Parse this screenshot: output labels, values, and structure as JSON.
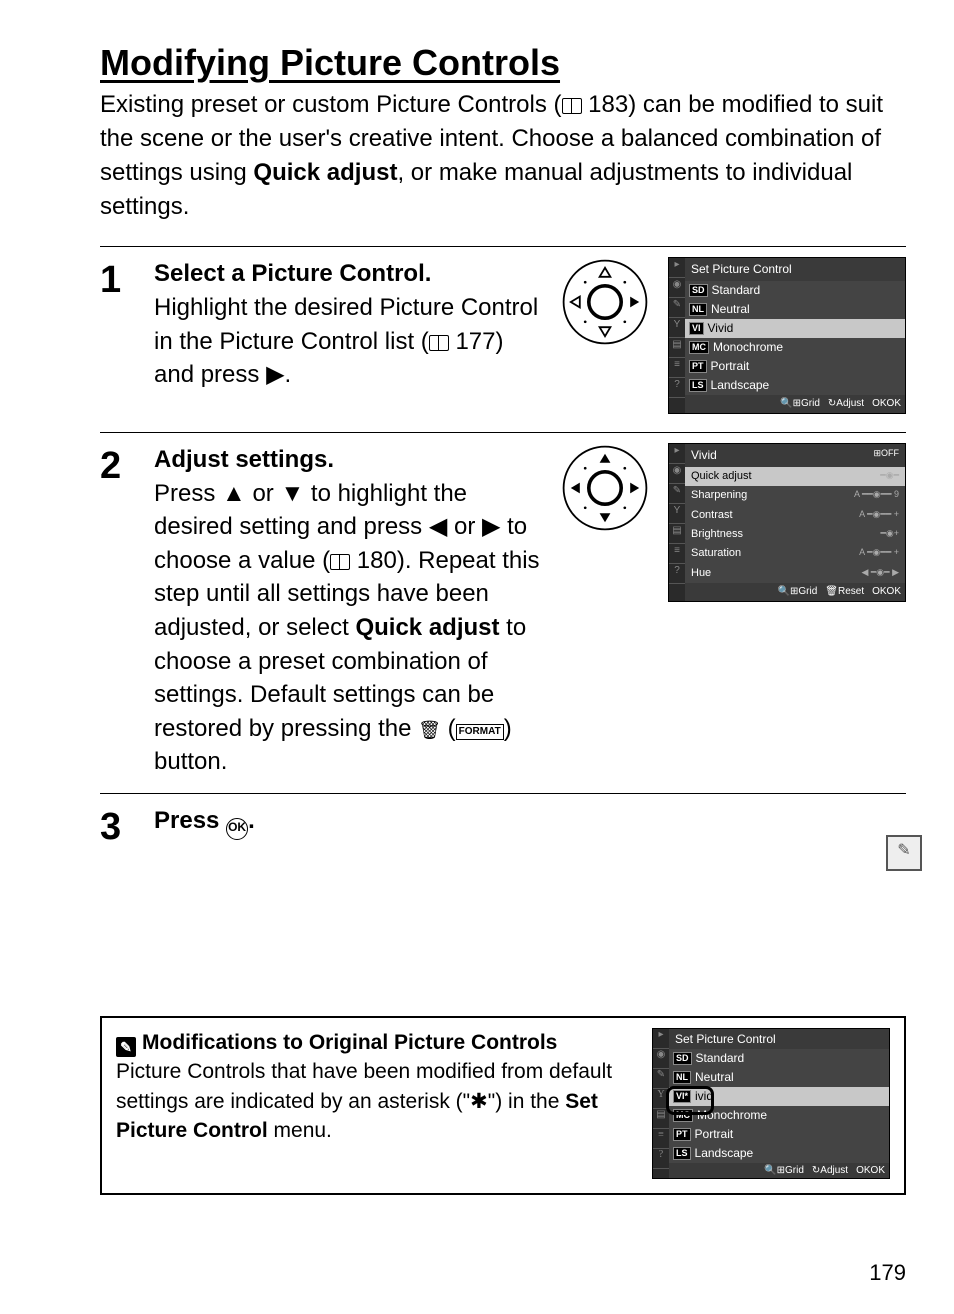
{
  "title": "Modifying Picture Controls",
  "intro_1": "Existing preset or custom Picture Controls (",
  "intro_ref1": " 183) can be modified to suit the scene or the user's creative intent.  Choose a balanced combination of settings using ",
  "intro_bold": "Quick adjust",
  "intro_tail": ", or make manual adjustments to individual settings.",
  "steps": {
    "s1": {
      "num": "1",
      "title": "Select a Picture Control.",
      "body_a": "Highlight the desired Picture Control in the Picture Control list (",
      "ref": " 177) and press ",
      "body_b": "."
    },
    "s2": {
      "num": "2",
      "title": "Adjust settings.",
      "body_a": "Press ",
      "body_b": " or ",
      "body_c": " to highlight the desired setting and press ",
      "body_d": " or ",
      "body_e": " to choose a value (",
      "ref": " 180).  Repeat this step until all settings have been adjusted, or select ",
      "bold": "Quick adjust",
      "body_f": " to choose a preset combination of settings.  Default settings can be restored by pressing the ",
      "body_g": " button."
    },
    "s3": {
      "num": "3",
      "title_a": "Press ",
      "title_b": "."
    }
  },
  "panel1": {
    "title": "Set Picture Control",
    "rows": [
      {
        "code": "SD",
        "label": "Standard"
      },
      {
        "code": "NL",
        "label": "Neutral"
      },
      {
        "code": "VI",
        "label": "Vivid"
      },
      {
        "code": "MC",
        "label": "Monochrome"
      },
      {
        "code": "PT",
        "label": "Portrait"
      },
      {
        "code": "LS",
        "label": "Landscape"
      }
    ],
    "footer": {
      "a": "Grid",
      "b": "Adjust",
      "c": "OK"
    }
  },
  "panel2": {
    "title": "Vivid",
    "rows": [
      {
        "label": "Quick adjust",
        "slider": "━◉━"
      },
      {
        "label": "Sharpening",
        "slider": "A ━━◉━━ 9"
      },
      {
        "label": "Contrast",
        "slider": "A ━◉━━ +"
      },
      {
        "label": "Brightness",
        "slider": "━◉+"
      },
      {
        "label": "Saturation",
        "slider": "A ━◉━━ +"
      },
      {
        "label": "Hue",
        "slider": "◀ ━◉━ ▶"
      }
    ],
    "footer": {
      "a": "Grid",
      "b": "Reset",
      "c": "OK"
    }
  },
  "infobox": {
    "title": "Modifications to Original Picture Controls",
    "text_a": "Picture Controls that have been modified from default settings are indicated by an asterisk (\"",
    "star": "✱",
    "text_b": "\") in the ",
    "bold": "Set Picture Control",
    "text_c": " menu."
  },
  "panel3": {
    "title": "Set Picture Control",
    "rows": [
      {
        "code": "SD",
        "label": "Standard"
      },
      {
        "code": "NL",
        "label": "Neutral"
      },
      {
        "code": "VI*",
        "label": "ivid"
      },
      {
        "code": "MC",
        "label": "Monochrome"
      },
      {
        "code": "PT",
        "label": "Portrait"
      },
      {
        "code": "LS",
        "label": "Landscape"
      }
    ],
    "footer": {
      "a": "Grid",
      "b": "Adjust",
      "c": "OK"
    }
  },
  "pagenum": "179",
  "glyphs": {
    "right": "▶",
    "left": "◀",
    "up": "▲",
    "down": "▼",
    "ok": "OK",
    "format": "FORMAT"
  }
}
